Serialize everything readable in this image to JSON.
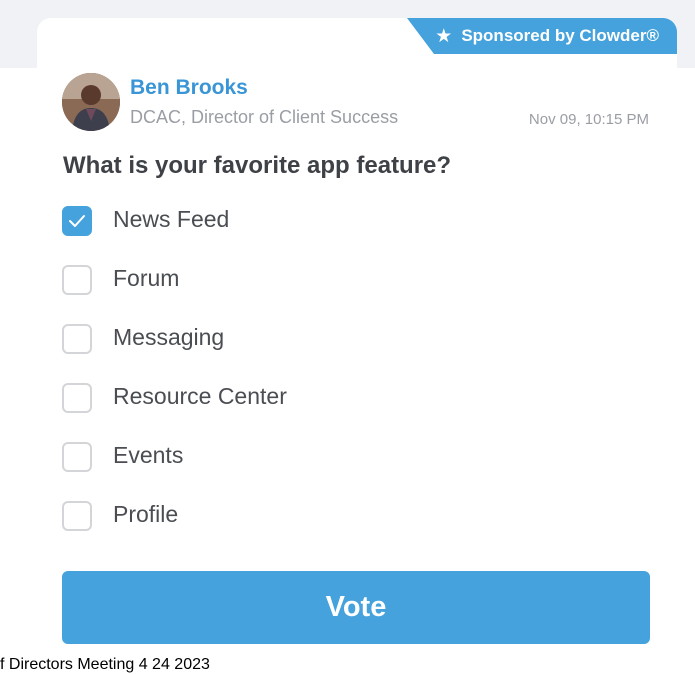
{
  "sponsor": {
    "label": "Sponsored by Clowder®",
    "icon": "star-icon"
  },
  "post": {
    "author_name": "Ben Brooks",
    "author_title": "DCAC, Director of Client Success",
    "timestamp": "Nov 09, 10:15 PM",
    "avatar_icon": "user-avatar"
  },
  "poll": {
    "question": "What is your favorite app feature?",
    "options": [
      {
        "label": "News Feed",
        "checked": true
      },
      {
        "label": "Forum",
        "checked": false
      },
      {
        "label": "Messaging",
        "checked": false
      },
      {
        "label": "Resource Center",
        "checked": false
      },
      {
        "label": "Events",
        "checked": false
      },
      {
        "label": "Profile",
        "checked": false
      }
    ],
    "vote_label": "Vote"
  },
  "footer": {
    "partial_text": "f Directors Meeting 4 24 2023"
  },
  "colors": {
    "accent": "#45a2dc",
    "name": "#3a95d6",
    "muted": "#9a9ea4",
    "text": "#4a4d52"
  }
}
